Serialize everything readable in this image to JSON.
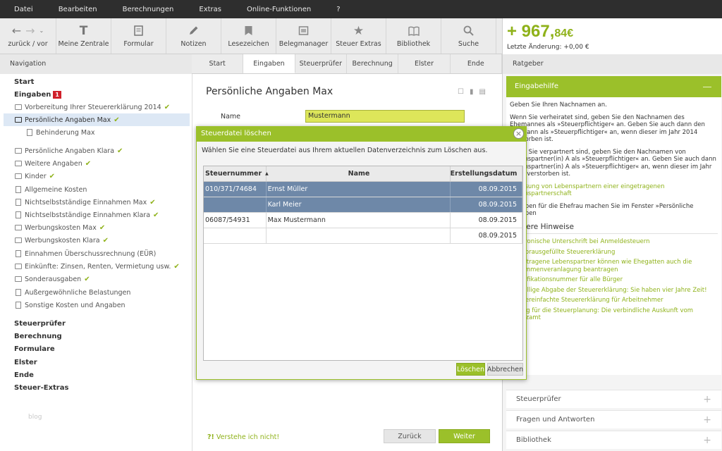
{
  "menu": [
    "Datei",
    "Bearbeiten",
    "Berechnungen",
    "Extras",
    "Online-Funktionen",
    "?"
  ],
  "toolbar": {
    "nav_label": "zurück / vor",
    "buttons": [
      {
        "label": "Meine Zentrale",
        "icon": "t-icon"
      },
      {
        "label": "Formular",
        "icon": "form-icon"
      },
      {
        "label": "Notizen",
        "icon": "pencil-icon"
      },
      {
        "label": "Lesezeichen",
        "icon": "bookmark-icon"
      },
      {
        "label": "Belegmanager",
        "icon": "receipt-icon"
      },
      {
        "label": "Steuer Extras",
        "icon": "star-icon"
      },
      {
        "label": "Bibliothek",
        "icon": "book-icon"
      },
      {
        "label": "Suche",
        "icon": "search-icon"
      }
    ]
  },
  "balance": {
    "main": "+ 967,",
    "cents": "84€",
    "last_change": "Letzte Änderung: +0,00 €"
  },
  "navigation": {
    "header": "Navigation",
    "items": [
      {
        "label": "Start",
        "bold": true
      },
      {
        "label": "Eingaben",
        "bold": true,
        "badge": "1"
      },
      {
        "label": "Vorbereitung Ihrer Steuererklärung 2014",
        "check": true
      },
      {
        "label": "Persönliche Angaben Max",
        "check": true,
        "selected": true
      },
      {
        "label": "Behinderung Max"
      },
      {
        "label": "Persönliche Angaben Klara",
        "check": true
      },
      {
        "label": "Weitere Angaben",
        "check": true
      },
      {
        "label": "Kinder",
        "check": true
      },
      {
        "label": "Allgemeine Kosten"
      },
      {
        "label": "Nichtselbstständige Einnahmen Max",
        "check": true
      },
      {
        "label": "Nichtselbstständige Einnahmen Klara",
        "check": true
      },
      {
        "label": "Werbungskosten Max",
        "check": true
      },
      {
        "label": "Werbungskosten Klara",
        "check": true
      },
      {
        "label": "Einnahmen Überschussrechnung (EÜR)"
      },
      {
        "label": "Einkünfte: Zinsen, Renten, Vermietung usw.",
        "check": true
      },
      {
        "label": "Sonderausgaben",
        "check": true
      },
      {
        "label": "Außergewöhnliche Belastungen"
      },
      {
        "label": "Sonstige Kosten und Angaben"
      },
      {
        "label": "Steuerprüfer",
        "bold": true
      },
      {
        "label": "Berechnung",
        "bold": true
      },
      {
        "label": "Formulare",
        "bold": true
      },
      {
        "label": "Elster",
        "bold": true
      },
      {
        "label": "Ende",
        "bold": true
      },
      {
        "label": "Steuer-Extras",
        "bold": true
      }
    ],
    "footer": "blog"
  },
  "tabs": [
    "Start",
    "Eingaben",
    "Steuerprüfer",
    "Berechnung",
    "Elster",
    "Ende"
  ],
  "main": {
    "title": "Persönliche Angaben Max",
    "name_label": "Name",
    "name_value": "Mustermann",
    "not_understood": "Verstehe ich nicht!",
    "not_understood_prefix": "?!",
    "back": "Zurück",
    "next": "Weiter"
  },
  "dialog": {
    "title": "Steuerdatei löschen",
    "description": "Wählen Sie eine Steuerdatei aus Ihrem aktuellen Datenverzeichnis zum Löschen aus.",
    "columns": [
      "Steuernummer",
      "Name",
      "Erstellungsdatum"
    ],
    "rows": [
      {
        "nr": "010/371/74684",
        "name": "Ernst Müller",
        "date": "08.09.2015"
      },
      {
        "nr": "",
        "name": "Karl Meier",
        "date": "08.09.2015"
      },
      {
        "nr": "06087/54931",
        "name": "Max Mustermann",
        "date": "08.09.2015"
      },
      {
        "nr": "",
        "name": "",
        "date": "08.09.2015"
      }
    ],
    "delete": "Löschen",
    "cancel": "Abbrechen"
  },
  "ratgeber": {
    "header": "Ratgeber",
    "card_title": "Eingabehilfe",
    "p1": "Geben Sie Ihren Nachnamen an.",
    "p2": "Wenn Sie verheiratet sind, geben Sie den Nachnamen des Ehemannes als »Steuerpflichtiger« an. Geben Sie auch dann den Ehemann als »Steuerpflichtiger« an, wenn dieser im Jahr 2014 verstorben ist.",
    "p3": "Wenn Sie verpartnert sind, geben Sie den Nachnamen von Lebenspartner(in) A als »Steuerpflichtiger« an. Geben Sie auch dann Lebenspartner(in) A als »Steuerpflichtiger« an, wenn dieser im Jahr 2014 verstorben ist.",
    "link1": "Erfassung von Lebenspartnern einer eingetragenen Lebenspartnerschaft",
    "p4": "Angaben für die Ehefrau machen Sie im Fenster »Persönliche Angaben",
    "hints_title": "Weitere Hinweise",
    "hints": [
      "Elektronische Unterschrift bei Anmeldesteuern",
      "Die vorausgefüllte Steuererklärung",
      "Eingetragene Lebenspartner können wie Ehegatten auch die Zusammenveranlagung beantragen",
      "Identifikationsnummer für alle Bürger",
      "Freiwillige Abgabe der Steuererklärung: Sie haben vier Jahre Zeit!",
      "Die vereinfachte Steuererklärung für Arbeitnehmer",
      "Antrag für die Steuerplanung: Die verbindliche Auskunft vom Finanzamt"
    ],
    "accordion": [
      "Steuerprüfer",
      "Fragen und Antworten",
      "Bibliothek"
    ]
  }
}
